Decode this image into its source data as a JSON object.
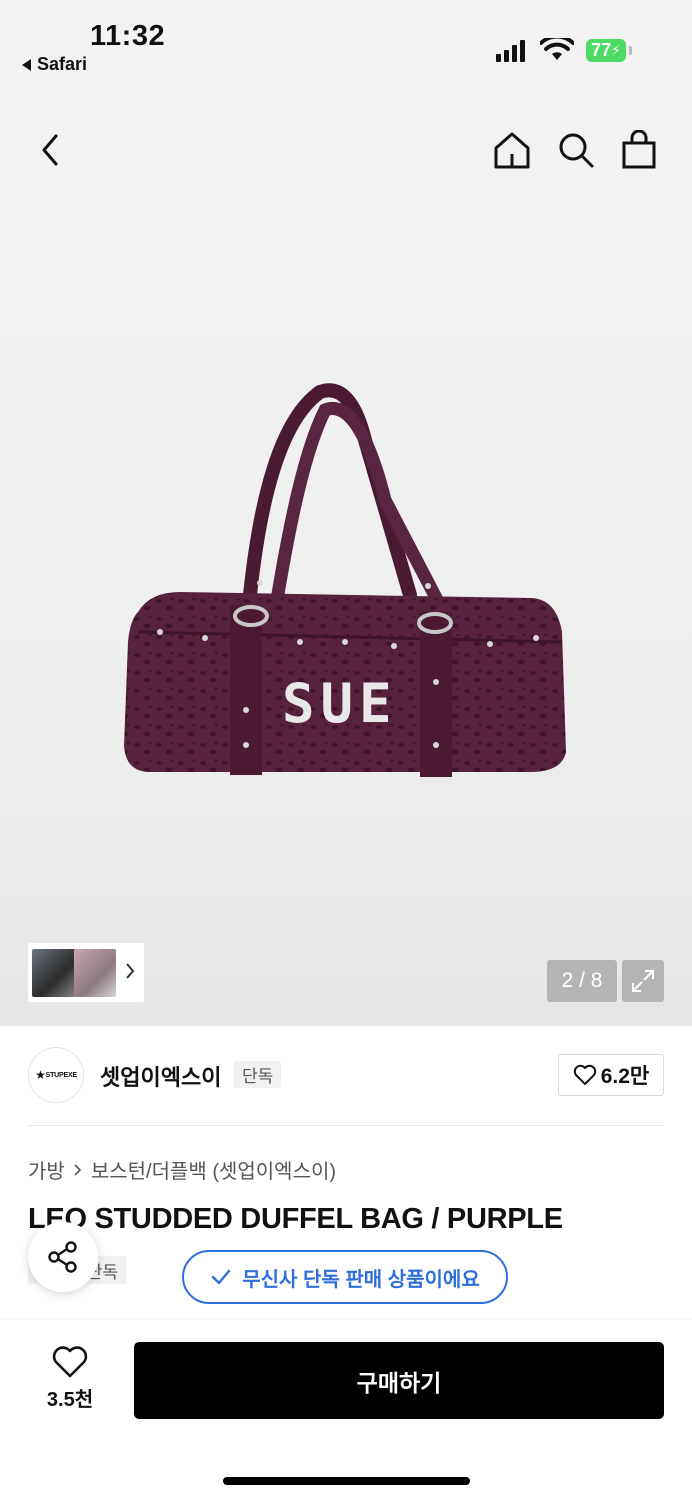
{
  "status_bar": {
    "time": "11:32",
    "back_app": "Safari",
    "battery": "77"
  },
  "nav": {
    "back_icon": "chevron-left-icon",
    "home_icon": "home-icon",
    "search_icon": "search-icon",
    "cart_icon": "shopping-bag-icon"
  },
  "gallery": {
    "product_lettering": "SUE",
    "counter": "2 / 8"
  },
  "brand": {
    "logo_text": "STUPEXE",
    "name": "셋업이엑스이",
    "exclusive": "단독",
    "likes": "6.2만"
  },
  "breadcrumb": {
    "category": "가방",
    "subcategory": "보스턴/더플백 (셋업이엑스이)"
  },
  "product": {
    "title": "LEO STUDDED DUFFEL BAG / PURPLE",
    "exclusive_badge": "단독"
  },
  "toast": {
    "message": "무신사 단독 판매 상품이에요"
  },
  "bottom_bar": {
    "wish_count": "3.5천",
    "buy_label": "구매하기"
  },
  "colors": {
    "accent_blue": "#2f6fdb",
    "battery_green": "#4cd964",
    "bag_purple": "#4f1f37"
  }
}
